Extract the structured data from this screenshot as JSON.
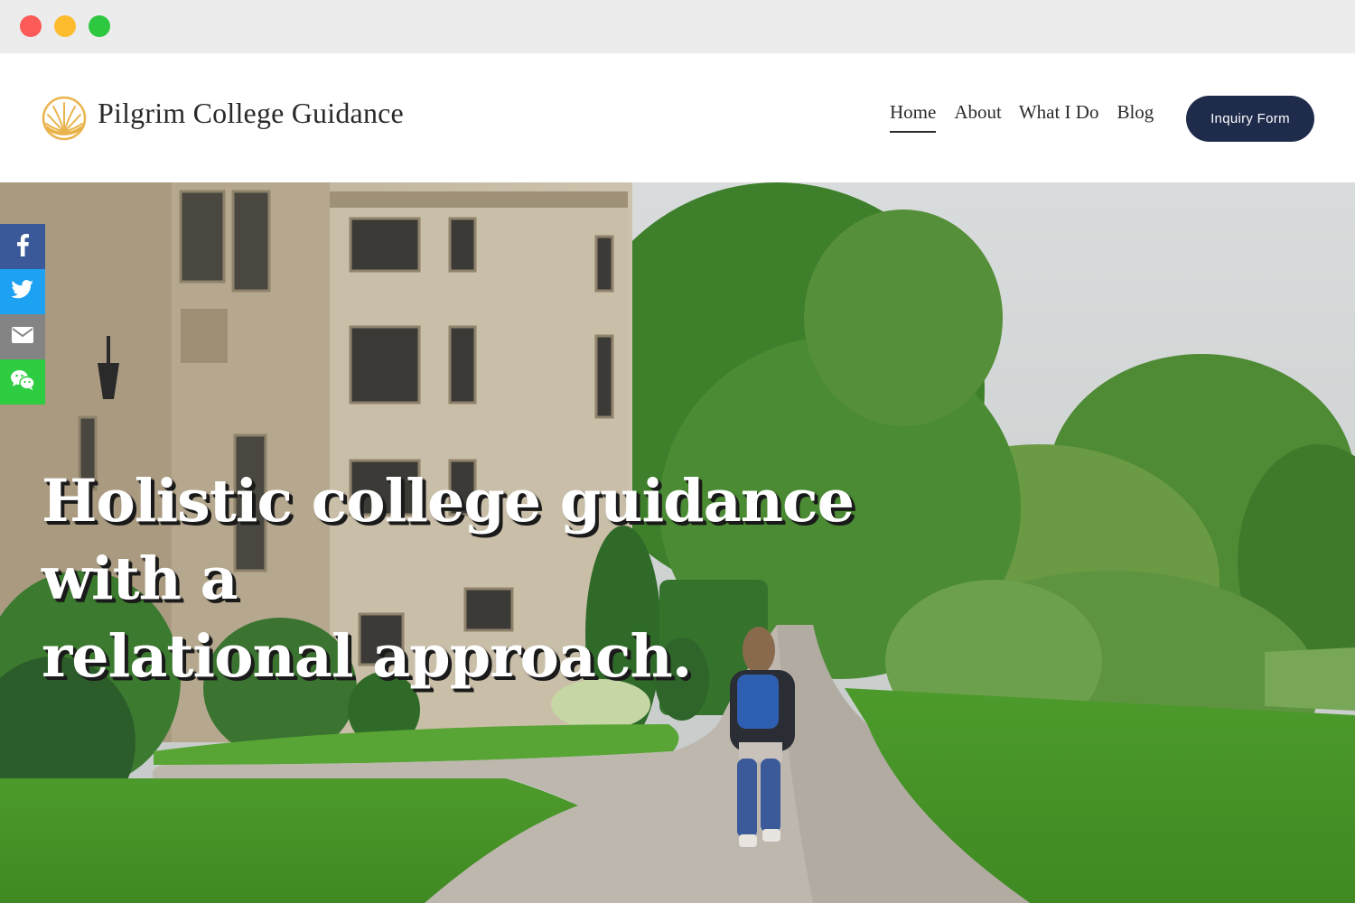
{
  "site": {
    "brand": "Pilgrim College Guidance",
    "nav": [
      {
        "label": "Home",
        "active": true
      },
      {
        "label": "About",
        "active": false
      },
      {
        "label": "What I Do",
        "active": false
      },
      {
        "label": "Blog",
        "active": false
      }
    ],
    "cta_label": "Inquiry Form"
  },
  "hero": {
    "headline_line1": "Holistic college guidance with a",
    "headline_line2": "relational approach."
  },
  "share": {
    "buttons": [
      {
        "icon": "facebook-icon",
        "color": "#3b5998"
      },
      {
        "icon": "twitter-icon",
        "color": "#1da1f2"
      },
      {
        "icon": "email-icon",
        "color": "#848484"
      },
      {
        "icon": "wechat-icon",
        "color": "#2ecc40"
      }
    ]
  },
  "colors": {
    "cta_bg": "#1e2b4b",
    "logo_gold": "#e9b44c"
  }
}
